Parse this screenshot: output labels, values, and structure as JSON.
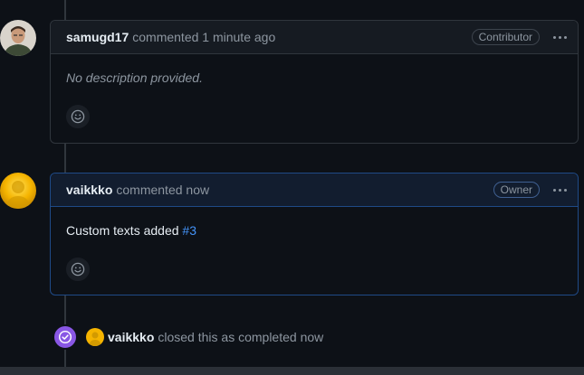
{
  "comments": [
    {
      "author": "samugd17",
      "meta": "commented 1 minute ago",
      "badge": "Contributor",
      "body": "No description provided."
    },
    {
      "author": "vaikkko",
      "meta": "commented now",
      "badge": "Owner",
      "body_text": "Custom texts added ",
      "body_link": "#3"
    }
  ],
  "event": {
    "author": "vaikkko",
    "text": "closed this as completed now"
  },
  "colors": {
    "accent": "#4493f8",
    "closed_badge": "#8957e5",
    "owner_border": "#1f4a87"
  },
  "icons": [
    "smiley-icon",
    "kebab-icon",
    "check-circle-icon"
  ]
}
